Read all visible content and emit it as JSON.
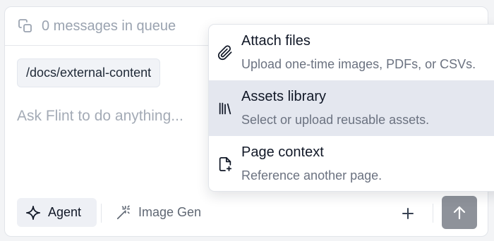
{
  "queue": {
    "text": "0 messages in queue",
    "icon": "queue-icon"
  },
  "context": {
    "path_chip": "/docs/external-content"
  },
  "prompt": {
    "placeholder": "Ask Flint to do anything...",
    "value": ""
  },
  "toolbar": {
    "agent_label": "Agent",
    "image_gen_label": "Image Gen",
    "add_icon": "plus-icon",
    "send_icon": "arrow-up-icon"
  },
  "menu": {
    "items": [
      {
        "title": "Attach files",
        "description": "Upload one-time images, PDFs, or CSVs.",
        "icon": "paperclip-icon",
        "highlighted": false
      },
      {
        "title": "Assets library",
        "description": "Select or upload reusable assets.",
        "icon": "library-icon",
        "highlighted": true
      },
      {
        "title": "Page context",
        "description": "Reference another page.",
        "icon": "file-plus-icon",
        "highlighted": false
      }
    ]
  },
  "colors": {
    "menu_highlight": "#e4e7ef",
    "send_button": "#8e929a",
    "chip_background": "#f1f3f7",
    "muted_text": "#9aa3b0"
  }
}
